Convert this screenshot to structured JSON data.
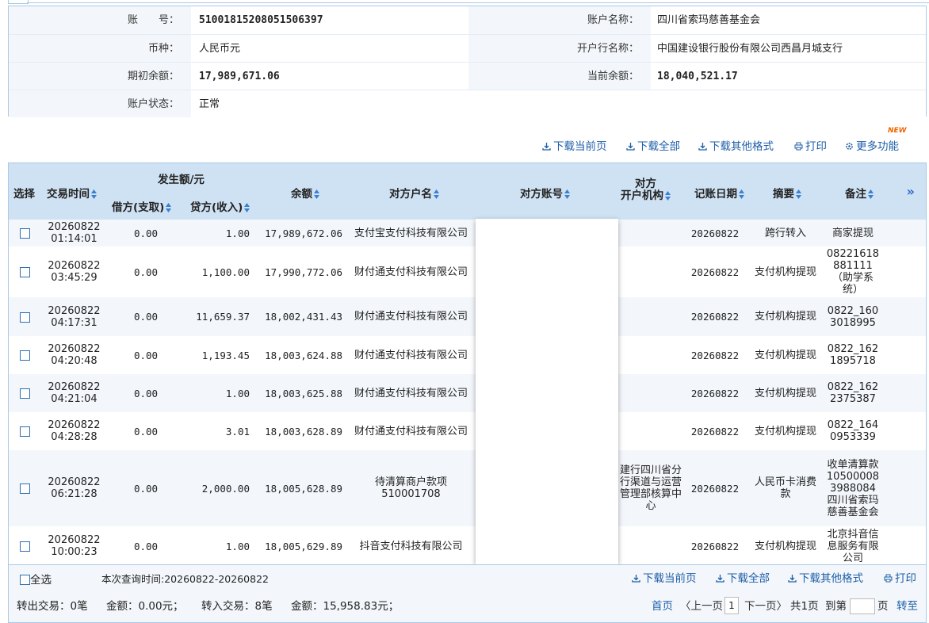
{
  "account": {
    "account_no_label": "账　　号：",
    "account_no": "51001815208051506397",
    "account_name_label": "账户名称：",
    "account_name": "四川省索玛慈善基金会",
    "currency_label": "币种：",
    "currency": "人民币元",
    "bank_label": "开户行名称：",
    "bank": "中国建设银行股份有限公司西昌月城支行",
    "opening_balance_label": "期初余额：",
    "opening_balance": "17,989,671.06",
    "current_balance_label": "当前余额：",
    "current_balance": "18,040,521.17",
    "status_label": "账户状态：",
    "status": "正常"
  },
  "toolbar": {
    "download_page": "下载当前页",
    "download_all": "下载全部",
    "download_other": "下载其他格式",
    "print": "打印",
    "more": "更多功能",
    "new_badge": "NEW"
  },
  "table": {
    "headers": {
      "select": "选择",
      "time": "交易时间",
      "amount_group": "发生额/元",
      "debit": "借方(支取)",
      "credit": "贷方(收入)",
      "balance": "余额",
      "counterparty": "对方户名",
      "counter_account": "对方账号",
      "counter_bank_l1": "对方",
      "counter_bank_l2": "开户机构",
      "post_date": "记账日期",
      "summary": "摘要",
      "remark": "备注",
      "more": "»"
    },
    "rows": [
      {
        "date": "20260822",
        "time": "01:14:01",
        "debit": "0.00",
        "credit": "1.00",
        "balance": "17,989,672.06",
        "name": "支付宝支付科技有限公司",
        "bank": "",
        "post": "20260822",
        "summary": "跨行转入",
        "remark": "商家提现"
      },
      {
        "date": "20260822",
        "time": "03:45:29",
        "debit": "0.00",
        "credit": "1,100.00",
        "balance": "17,990,772.06",
        "name": "财付通支付科技有限公司",
        "bank": "",
        "post": "20260822",
        "summary": "支付机构提现",
        "remark": "08221618881111（助学系统）"
      },
      {
        "date": "20260822",
        "time": "04:17:31",
        "debit": "0.00",
        "credit": "11,659.37",
        "balance": "18,002,431.43",
        "name": "财付通支付科技有限公司",
        "bank": "",
        "post": "20260822",
        "summary": "支付机构提现",
        "remark": "0822_1603018995"
      },
      {
        "date": "20260822",
        "time": "04:20:48",
        "debit": "0.00",
        "credit": "1,193.45",
        "balance": "18,003,624.88",
        "name": "财付通支付科技有限公司",
        "bank": "",
        "post": "20260822",
        "summary": "支付机构提现",
        "remark": "0822_1621895718"
      },
      {
        "date": "20260822",
        "time": "04:21:04",
        "debit": "0.00",
        "credit": "1.00",
        "balance": "18,003,625.88",
        "name": "财付通支付科技有限公司",
        "bank": "",
        "post": "20260822",
        "summary": "支付机构提现",
        "remark": "0822_1622375387"
      },
      {
        "date": "20260822",
        "time": "04:28:28",
        "debit": "0.00",
        "credit": "3.01",
        "balance": "18,003,628.89",
        "name": "财付通支付科技有限公司",
        "bank": "",
        "post": "20260822",
        "summary": "支付机构提现",
        "remark": "0822_1640953339"
      },
      {
        "date": "20260822",
        "time": "06:21:28",
        "debit": "0.00",
        "credit": "2,000.00",
        "balance": "18,005,628.89",
        "name": "待清算商户款项510001708",
        "bank": "建行四川省分行渠道与运营管理部核算中心",
        "post": "20260822",
        "summary": "人民币卡消费款",
        "remark": "收单清算款105000083988084四川省索玛慈善基金会"
      },
      {
        "date": "20260822",
        "time": "10:00:23",
        "debit": "0.00",
        "credit": "1.00",
        "balance": "18,005,629.89",
        "name": "抖音支付科技有限公司",
        "bank": "",
        "post": "20260822",
        "summary": "支付机构提现",
        "remark": "北京抖音信息服务有限公司"
      }
    ]
  },
  "footer": {
    "select_all": "全选",
    "query_time": "本次查询时间:20260822-20260822",
    "download_page": "下载当前页",
    "download_all": "下载全部",
    "download_other": "下载其他格式",
    "print": "打印",
    "out_tx": "转出交易：0笔",
    "out_amount": "金额：0.00元；",
    "in_tx": "转入交易：8笔",
    "in_amount": "金额：15,958.83元；",
    "first": "首页",
    "prev": "〈上一页",
    "page": "1",
    "next": "下一页〉",
    "total": "共1页",
    "goto": "到第",
    "page_unit": "页",
    "go": "转至"
  },
  "colors": {
    "link": "#1f5fa8",
    "header_bg": "#cfe2f4",
    "border": "#a9c9e6",
    "stripe": "#f3f7fb",
    "new_badge": "#ee6600"
  }
}
